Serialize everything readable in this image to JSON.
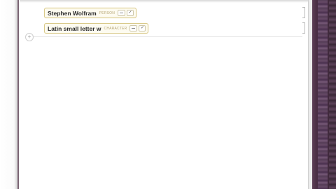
{
  "notebook": {
    "cells": [
      {
        "entity_name": "Stephen Wolfram",
        "entity_type": "PERSON",
        "expand_icon": "ellipsis-icon",
        "confirm_icon": "check-icon"
      },
      {
        "entity_name": "Latin small letter w",
        "entity_type": "CHARACTER",
        "expand_icon": "ellipsis-icon",
        "confirm_icon": "check-icon"
      }
    ],
    "insert_glyph": "+"
  },
  "colors": {
    "entity_border": "#d9c98a",
    "entity_background": "#fdfbf0",
    "entity_type_text": "#b8a878",
    "desktop_purple": "#4a2f44"
  }
}
